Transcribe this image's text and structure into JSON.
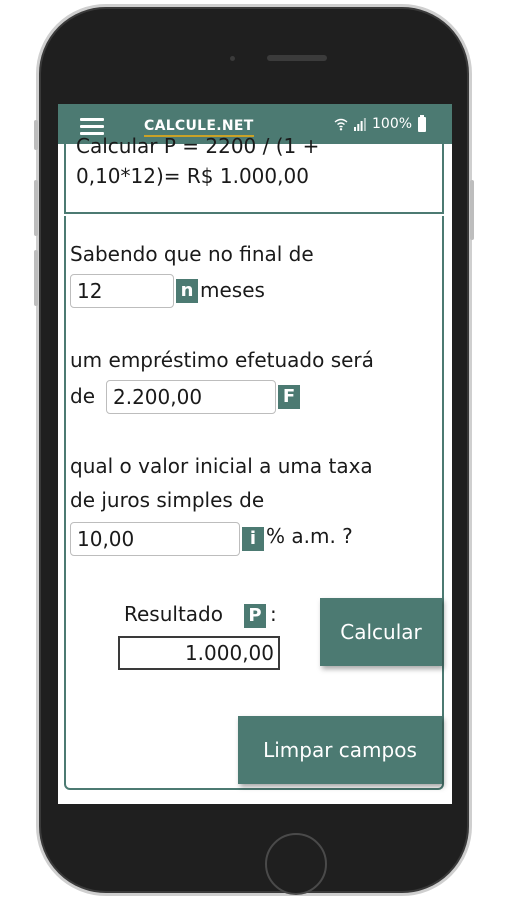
{
  "status_bar": {
    "app_title": "CALCULE.NET",
    "battery": "100%"
  },
  "formula": {
    "line1_partial": "Calcular P = 2200 / (1 +",
    "line2": "0,10*12)= R$ 1.000,00"
  },
  "form": {
    "intro_text": "Sabendo que no final de",
    "months_value": "12",
    "n_tag": "n",
    "months_suffix": "meses",
    "loan_text": "um empréstimo efetuado será",
    "de_text": "de",
    "future_value": "2.200,00",
    "f_tag": "F",
    "question_line1": "qual o valor inicial a uma taxa",
    "question_line2": "de juros simples de",
    "rate_value": "10,00",
    "i_tag": "i",
    "rate_suffix": "% a.m. ?",
    "result_label": "Resultado",
    "p_tag": "P",
    "result_colon": ":",
    "result_value": "1.000,00"
  },
  "buttons": {
    "calculate": "Calcular",
    "clear": "Limpar campos"
  },
  "colors": {
    "accent": "#4c7a72",
    "title_underline": "#c9a227"
  },
  "icons": [
    "menu-icon",
    "wifi-icon",
    "signal-icon",
    "battery-icon"
  ]
}
